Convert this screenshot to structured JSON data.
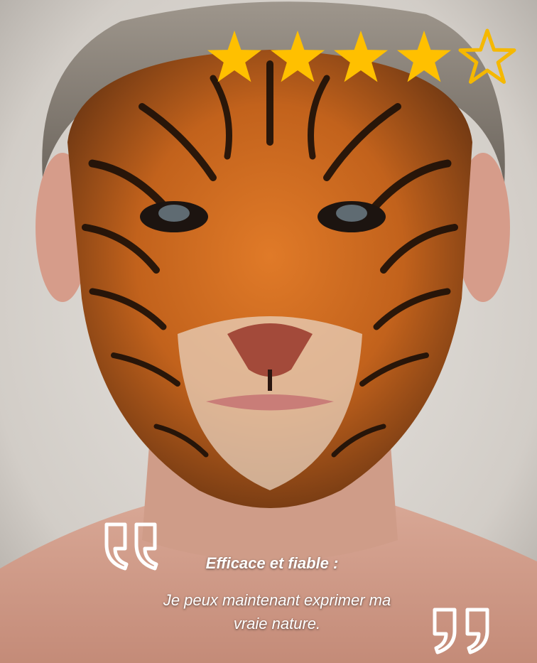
{
  "rating": {
    "value": 4,
    "max": 5,
    "star_color": "#FFC000",
    "outline_color": "#F5B800"
  },
  "testimonial": {
    "headline": "Efficace et fiable :",
    "line1": "Je peux maintenant exprimer ma",
    "line2": "vraie nature."
  },
  "colors": {
    "text": "#FFFFFF",
    "quote_marks": "#FFFFFF"
  },
  "icons": {
    "open_quote": "open-quote-icon",
    "close_quote": "close-quote-icon"
  }
}
